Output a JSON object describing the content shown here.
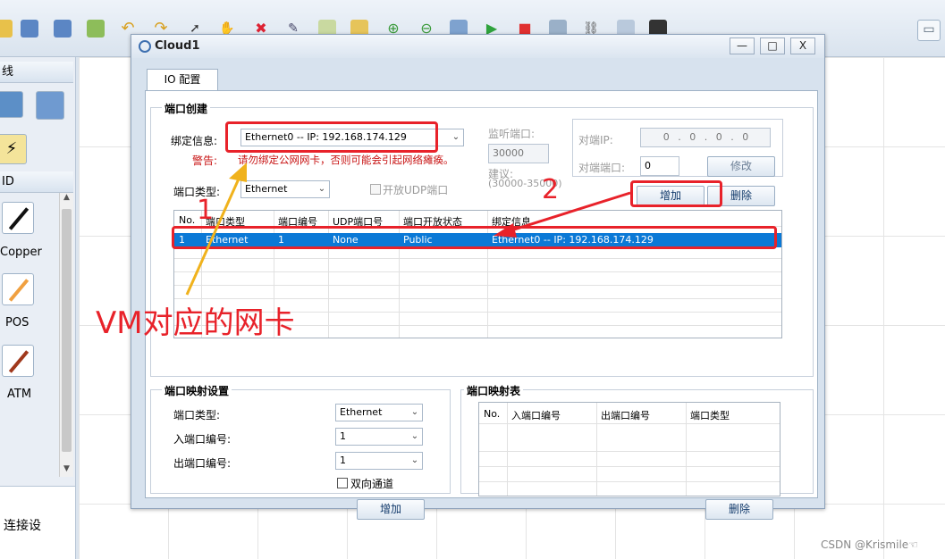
{
  "toolbar": {
    "icons": [
      "file-icon",
      "save-icon",
      "save-as-icon",
      "print-icon",
      "undo-icon",
      "redo-icon",
      "pointer-icon",
      "hand-icon",
      "delete-icon",
      "edit-icon",
      "text-icon",
      "palette-icon",
      "zoom-in-icon",
      "zoom-out-icon",
      "fit-icon",
      "start-icon",
      "stop-icon",
      "capture-icon",
      "topology-icon",
      "grid-icon",
      "terminal-icon",
      "chat-icon"
    ]
  },
  "left_panel": {
    "top_label": "线",
    "device_label": "ID",
    "connection_labels": [
      "Copper",
      "POS",
      "ATM"
    ],
    "bottom_label": "连接设"
  },
  "dialog": {
    "title": "Cloud1",
    "minimize": "—",
    "maximize": "□",
    "close": "X",
    "tab": "IO 配置",
    "port_create": {
      "section_title": "端口创建",
      "bind_label": "绑定信息:",
      "bind_value": "Ethernet0 -- IP: 192.168.174.129",
      "warning_label": "警告:",
      "warning_text": "请勿绑定公网网卡，否则可能会引起网络瘫痪。",
      "port_type_label": "端口类型:",
      "port_type_value": "Ethernet",
      "udp_checkbox_label": "开放UDP端口",
      "listen_port_label": "监听端口:",
      "listen_port_value": "30000",
      "suggest_label": "建议:",
      "suggest_range": "(30000-35000)",
      "peer_ip_label": "对端IP:",
      "peer_ip_value": "0 . 0 . 0 . 0",
      "peer_port_label": "对端端口:",
      "peer_port_value": "0",
      "modify_button": "修改",
      "add_button": "增加",
      "delete_button": "删除"
    },
    "port_table": {
      "headers": [
        "No.",
        "端口类型",
        "端口编号",
        "UDP端口号",
        "端口开放状态",
        "绑定信息"
      ],
      "rows": [
        [
          "1",
          "Ethernet",
          "1",
          "None",
          "Public",
          "Ethernet0 -- IP: 192.168.174.129"
        ]
      ]
    },
    "mapping_settings": {
      "section_title": "端口映射设置",
      "port_type_label": "端口类型:",
      "port_type_value": "Ethernet",
      "in_port_label": "入端口编号:",
      "in_port_value": "1",
      "out_port_label": "出端口编号:",
      "out_port_value": "1",
      "bidirectional_label": "双向通道",
      "add_button": "增加"
    },
    "mapping_table": {
      "section_title": "端口映射表",
      "headers": [
        "No.",
        "入端口编号",
        "出端口编号",
        "端口类型"
      ],
      "delete_button": "删除"
    }
  },
  "annotations": {
    "label_1": "1",
    "label_2": "2",
    "vm_text": "VM对应的网卡",
    "color": "#e8222a"
  },
  "watermark": "CSDN @Krismile☜"
}
